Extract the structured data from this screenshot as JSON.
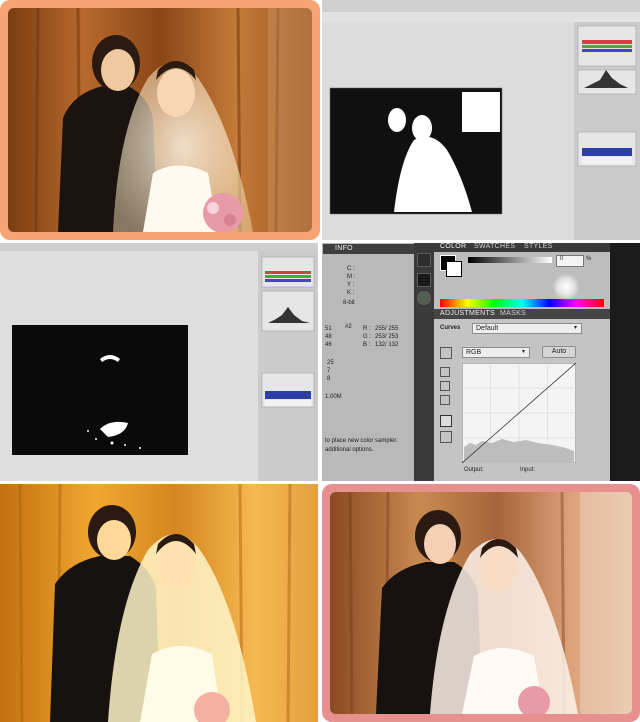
{
  "tiles": {
    "original_photo": {
      "frame_color": "#f7a474"
    },
    "threshold_white": {
      "canvas_color": "#111111"
    },
    "threshold_highlights": {
      "canvas_color": "#0a0a0a"
    },
    "adjustments_panel": {
      "top_tab_info": "INFO",
      "top_tab_color": "COLOR",
      "top_tab_swatches": "SWATCHES",
      "top_tab_styles": "STYLES",
      "color_value": "0",
      "color_unit": "%",
      "info_c": "C :",
      "info_m": "M :",
      "info_y": "Y :",
      "info_k": "K :",
      "info_bit": "8-bit",
      "sample_id": "#2",
      "sample_r_label": "R :",
      "sample_r": "255/ 255",
      "sample_g_label": "G :",
      "sample_g": "253/ 253",
      "sample_b_label": "B :",
      "sample_b": "132/ 132",
      "left_nums": [
        "51",
        "48",
        "46"
      ],
      "left_nums2": [
        "25",
        "7",
        "8"
      ],
      "doc_label": "1.00M",
      "hint_line1": "to place new color sampler.",
      "hint_line2": "additional options.",
      "adj_tab": "ADJUSTMENTS",
      "masks_tab": "MASKS",
      "curves_label": "Curves",
      "preset_value": "Default",
      "channel_value": "RGB",
      "auto_button": "Auto",
      "output_label": "Output:",
      "input_label": "Input:"
    },
    "curves_result": {},
    "final_photo": {
      "frame_color": "#e8908e"
    }
  }
}
